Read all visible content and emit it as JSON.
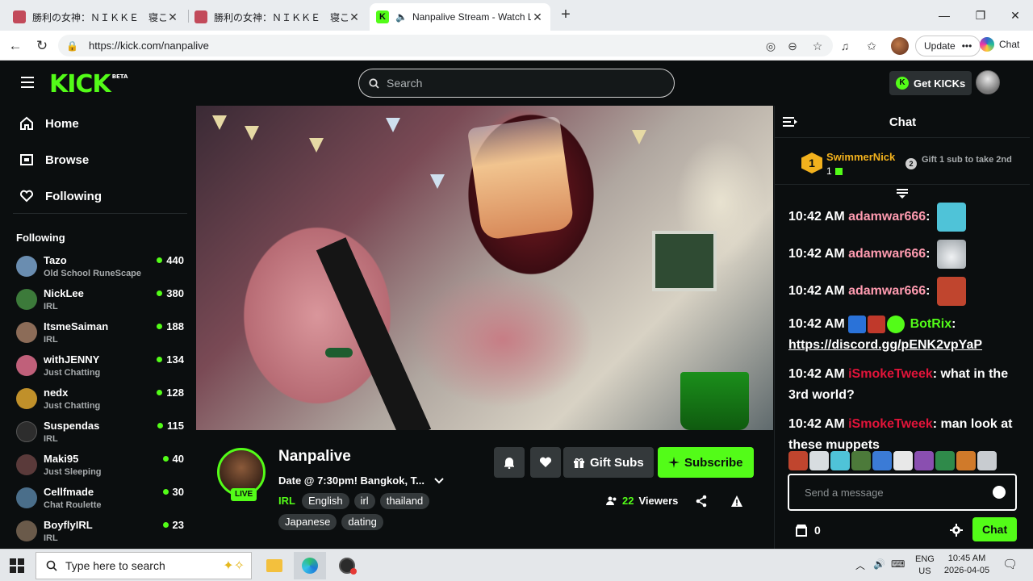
{
  "browser": {
    "tabs": [
      {
        "title": "勝利の女神：ＮＩＫＫＥ　寝ころび",
        "active": false
      },
      {
        "title": "勝利の女神：ＮＩＫＫＥ　寝ころび",
        "active": false
      },
      {
        "title": "Nanpalive Stream - Watch Live",
        "active": true
      }
    ],
    "url": "https://kick.com/nanpalive",
    "update_label": "Update",
    "chat_label": "Chat",
    "new_tab_icon": "plus-icon"
  },
  "kick": {
    "logo": "KICK",
    "logo_beta": "BETA",
    "search_placeholder": "Search",
    "get_kicks_label": "Get KICKs",
    "brand_color": "#53fc18",
    "sidebar": {
      "nav": [
        {
          "label": "Home",
          "icon": "home-icon"
        },
        {
          "label": "Browse",
          "icon": "browse-icon"
        },
        {
          "label": "Following",
          "icon": "heart-icon"
        }
      ],
      "following_title": "Following",
      "channels": [
        {
          "name": "Tazo",
          "category": "Old School RuneScape",
          "viewers": "440",
          "avatar_color": "#6a8db0"
        },
        {
          "name": "NickLee",
          "category": "IRL",
          "viewers": "380",
          "avatar_color": "#3c7a3a"
        },
        {
          "name": "ItsmeSaiman",
          "category": "IRL",
          "viewers": "188",
          "avatar_color": "#8c6c58"
        },
        {
          "name": "withJENNY",
          "category": "Just Chatting",
          "viewers": "134",
          "avatar_color": "#c0607a"
        },
        {
          "name": "nedx",
          "category": "Just Chatting",
          "viewers": "128",
          "avatar_color": "#c0902a"
        },
        {
          "name": "Suspendas",
          "category": "IRL",
          "viewers": "115",
          "avatar_color": "#2d2d2d"
        },
        {
          "name": "Maki95",
          "category": "Just Sleeping",
          "viewers": "40",
          "avatar_color": "#5a3a3a"
        },
        {
          "name": "Cellfmade",
          "category": "Chat Roulette",
          "viewers": "30",
          "avatar_color": "#4a6e8a"
        },
        {
          "name": "BoyflyIRL",
          "category": "IRL",
          "viewers": "23",
          "avatar_color": "#6a5a4a"
        }
      ]
    },
    "stream": {
      "streamer": "Nanpalive",
      "live_label": "LIVE",
      "title": "Date @ 7:30pm! Bangkok, T...",
      "category": "IRL",
      "tags": [
        "English",
        "irl",
        "thailand",
        "Japanese",
        "dating"
      ],
      "gift_label": "Gift Subs",
      "subscribe_label": "Subscribe",
      "viewers": "22",
      "viewers_label": "Viewers"
    },
    "chat": {
      "title": "Chat",
      "leaderboard": {
        "rank": "1",
        "name": "SwimmerNick",
        "count": "1",
        "second_rank": "2",
        "second_text": "Gift 1 sub to take 2nd"
      },
      "messages": [
        {
          "time": "10:42 AM",
          "user": "adamwar666",
          "user_color": "#ff9bb0",
          "text": "",
          "emote_color": "#4fc3d8"
        },
        {
          "time": "10:42 AM",
          "user": "adamwar666",
          "user_color": "#ff9bb0",
          "text": "",
          "emote_color": "#d8dde0"
        },
        {
          "time": "10:42 AM",
          "user": "adamwar666",
          "user_color": "#ff9bb0",
          "text": "",
          "emote_color": "#c0452e"
        },
        {
          "time": "10:42 AM",
          "user": "BotRix",
          "user_color": "#53fc18",
          "text": "https://discord.gg/pENK2vpYaP",
          "bot": true
        },
        {
          "time": "10:42 AM",
          "user": "iSmokeTweek",
          "user_color": "#e2143a",
          "text": "what in the 3rd world?"
        },
        {
          "time": "10:42 AM",
          "user": "iSmokeTweek",
          "user_color": "#e2143a",
          "text": "man look at these muppets"
        }
      ],
      "input_placeholder": "Send a message",
      "kicks_count": "0",
      "send_label": "Chat"
    }
  },
  "taskbar": {
    "search_placeholder": "Type here to search",
    "lang_top": "ENG",
    "lang_bottom": "US",
    "time": "10:45 AM",
    "date": "2026-04-05"
  }
}
